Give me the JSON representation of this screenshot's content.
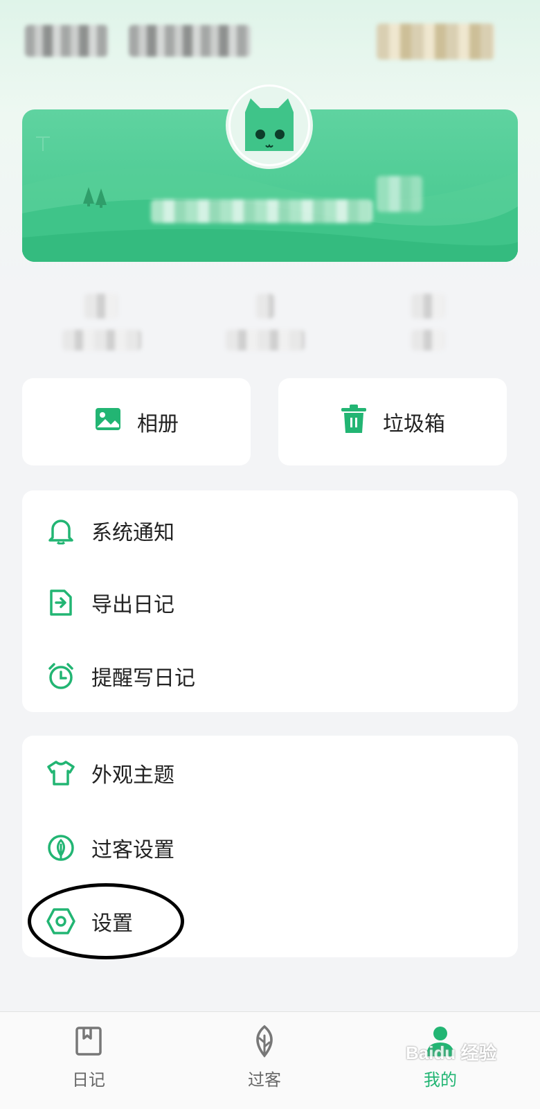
{
  "colors": {
    "accent": "#22b573",
    "banner": "#42c68c"
  },
  "quick_actions": [
    {
      "label": "相册",
      "icon": "image-icon"
    },
    {
      "label": "垃圾箱",
      "icon": "trash-icon"
    }
  ],
  "menu_group_1": [
    {
      "label": "系统通知",
      "icon": "bell-icon"
    },
    {
      "label": "导出日记",
      "icon": "export-icon"
    },
    {
      "label": "提醒写日记",
      "icon": "alarm-clock-icon"
    }
  ],
  "menu_group_2": [
    {
      "label": "外观主题",
      "icon": "shirt-icon"
    },
    {
      "label": "过客设置",
      "icon": "leaf-icon"
    },
    {
      "label": "设置",
      "icon": "gear-icon"
    }
  ],
  "tabbar": [
    {
      "label": "日记",
      "icon": "diary-icon"
    },
    {
      "label": "过客",
      "icon": "leaf-icon"
    },
    {
      "label": "我的",
      "icon": "user-icon",
      "active": true
    }
  ],
  "watermark": "Baidu 经验"
}
